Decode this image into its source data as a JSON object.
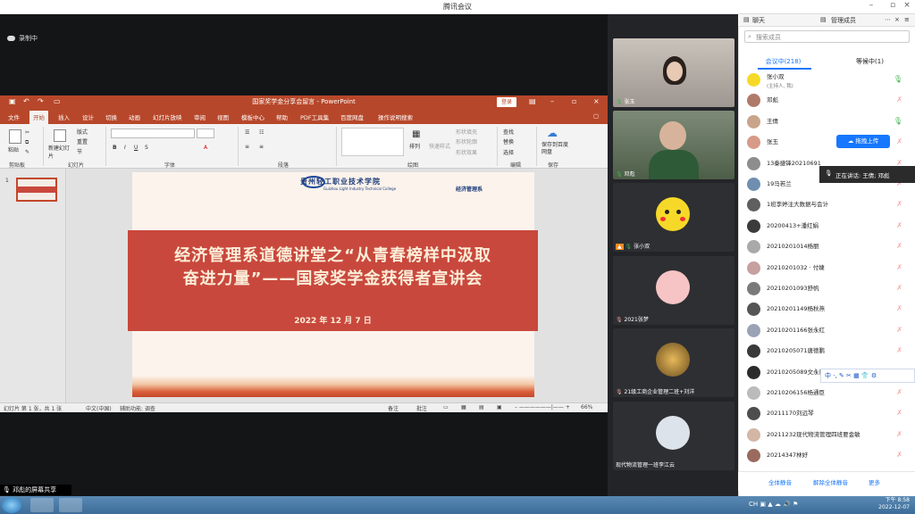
{
  "window": {
    "title": "腾讯会议"
  },
  "recording": {
    "label": "录制中"
  },
  "ppt": {
    "title": "国家奖学金分享会留言 - PowerPoint",
    "login_label": "登录",
    "tabs": [
      "文件",
      "开始",
      "插入",
      "设计",
      "切换",
      "动画",
      "幻灯片放映",
      "审阅",
      "视图",
      "模板中心",
      "帮助",
      "PDF工具集",
      "百度网盘",
      "操作说明搜索"
    ],
    "active_tab": "开始",
    "ribbon": {
      "clipboard_group": "剪贴板",
      "paste_label": "粘贴",
      "slides_group": "幻灯片",
      "new_slide_label": "新建幻灯片",
      "layout_label": "版式",
      "reset_label": "重置",
      "section_label": "节",
      "font_group": "字体",
      "paragraph_group": "段落",
      "drawing_group": "绘图",
      "arrange_label": "排列",
      "quick_styles_label": "快速样式",
      "fill_label": "形状填充",
      "outline_label": "形状轮廓",
      "effects_label": "形状效果",
      "editing_group": "编辑",
      "find_label": "查找",
      "replace_label": "替换",
      "select_label": "选择",
      "save_group": "保存",
      "save_baidu_label": "保存到百度网盘"
    },
    "slide": {
      "school_name": "贵州轻工职业技术学院",
      "school_en": "Guizhou Light Industry Technical College",
      "dept_logo": "经济管理系",
      "title_line1": "经济管理系道德讲堂之“从青春榜样中汲取",
      "title_line2": "奋进力量”——国家奖学金获得者宣讲会",
      "date": "2022 年 12 月 7 日"
    },
    "status": {
      "slide_count": "幻灯片 第 1 张，共 1 张",
      "language": "中文(中国)",
      "accessibility": "辅助功能: 调查",
      "notes": "备注",
      "comments": "批注",
      "zoom": "66%"
    }
  },
  "share_label": "邓彪的屏幕共享",
  "videos": [
    {
      "name": "张玉",
      "mic": "on"
    },
    {
      "name": "邓彪",
      "mic": "on"
    },
    {
      "name": "张小双",
      "mic": "on"
    },
    {
      "name": "2021张梦",
      "mic": "off"
    },
    {
      "name": "21级工商企业管理二班+刘洋",
      "mic": "off"
    },
    {
      "name": "现代物流管理一班李江云",
      "mic": "off"
    }
  ],
  "panel": {
    "tab_chat": "聊天",
    "tab_members": "管理成员",
    "search_placeholder": "搜索成员",
    "in_meeting": "会议中(218)",
    "waiting": "等候中(1)",
    "members": [
      {
        "name": "张小双",
        "sub": "(主持人, 我)",
        "mic": "on"
      },
      {
        "name": "邓彪",
        "sub": "",
        "mic": "off"
      },
      {
        "name": "王倩",
        "sub": "",
        "mic": "on"
      },
      {
        "name": "张玉",
        "sub": "",
        "mic": "off"
      },
      {
        "name": "13秦捷锋20210691",
        "sub": "",
        "mic": "off"
      },
      {
        "name": "19马若兰",
        "sub": "",
        "mic": "off"
      },
      {
        "name": "1班李婷注大数据与会计",
        "sub": "",
        "mic": "off"
      },
      {
        "name": "20200413+潘红娟",
        "sub": "",
        "mic": "off"
      },
      {
        "name": "20210201014杨丽",
        "sub": "",
        "mic": "off"
      },
      {
        "name": "20210201032 · 付婕",
        "sub": "",
        "mic": "off"
      },
      {
        "name": "20210201093舒帆",
        "sub": "",
        "mic": "off"
      },
      {
        "name": "20210201149杨秋燕",
        "sub": "",
        "mic": "off"
      },
      {
        "name": "20210201166张永红",
        "sub": "",
        "mic": "off"
      },
      {
        "name": "20210205071唐德鹏",
        "sub": "",
        "mic": "off"
      },
      {
        "name": "20210205089文永康",
        "sub": "",
        "mic": "off"
      },
      {
        "name": "20210206156杨通臣",
        "sub": "",
        "mic": "off"
      },
      {
        "name": "20211170刘远琴",
        "sub": "",
        "mic": "off"
      },
      {
        "name": "20211232现代物流管理四班要金敏",
        "sub": "",
        "mic": "off"
      },
      {
        "name": "20214347林好",
        "sub": "",
        "mic": "off"
      }
    ],
    "upload_label": "拖拽上传",
    "speaking": "正在讲话: 王倩; 邓彪",
    "footer": {
      "mute_all": "全体静音",
      "unmute_all": "解除全体静音",
      "more": "更多"
    }
  },
  "taskbar": {
    "time": "下午 8:58",
    "date": "2022-12-07",
    "lang": "CH"
  },
  "colors": {
    "ppt_red": "#b7472a",
    "slide_band": "#c9483d",
    "accent_blue": "#1677ff"
  }
}
